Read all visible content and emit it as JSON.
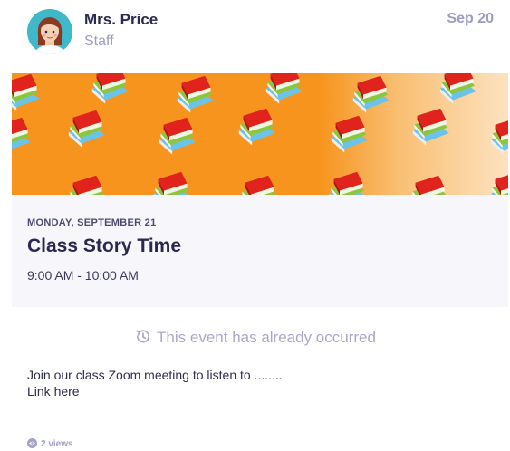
{
  "post": {
    "author_name": "Mrs. Price",
    "author_role": "Staff",
    "date": "Sep 20",
    "avatar_icon": "teacher-avatar-icon"
  },
  "event": {
    "day": "MONDAY, SEPTEMBER 21",
    "title": "Class Story Time",
    "time": "9:00 AM - 10:00 AM",
    "banner_icon": "books-pattern"
  },
  "status": {
    "message": "This event has already occurred",
    "icon": "history-clock-icon"
  },
  "body": {
    "line1": "Join our class Zoom meeting to listen to ........",
    "line2": "Link here"
  },
  "views": {
    "label": "2 views",
    "icon": "eye-icon"
  },
  "colors": {
    "accent_muted": "#a9a8cc",
    "title_dark": "#2a2850",
    "banner_orange": "#f7941d"
  }
}
